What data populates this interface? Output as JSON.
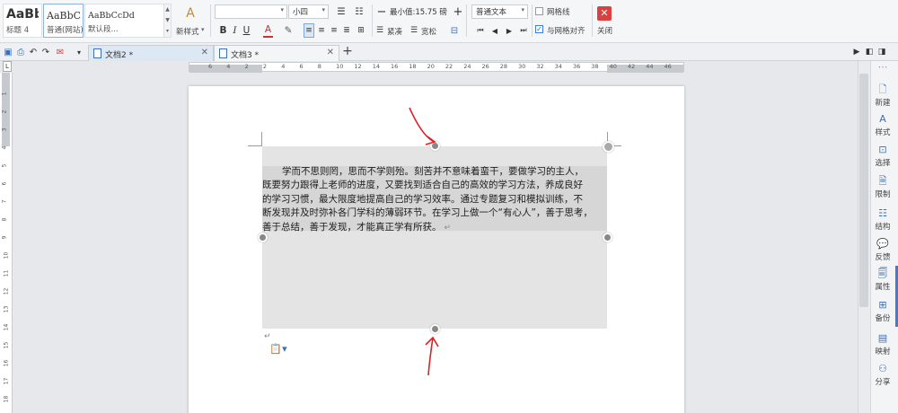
{
  "ribbon": {
    "styles": [
      {
        "preview": "AaBbC",
        "name": "标题 4"
      },
      {
        "preview": "AaBbCcl",
        "name": "普通(网站)"
      },
      {
        "preview": "AaBbCcDd",
        "name": "默认段..."
      }
    ],
    "new_style_label": "新样式",
    "font_name": "",
    "font_size": "小四",
    "line_spacing_label": "最小值:15.75 磅",
    "minus": "−",
    "plus": "+",
    "text_style": "普通文本",
    "gridlines_label": "网格线",
    "align_grid_label": "与网格对齐",
    "close_label": "关闭",
    "tight_label": "紧凑",
    "loose_label": "宽松",
    "bold": "B",
    "italic": "I",
    "underline": "U",
    "fontcolor": "A"
  },
  "tabs": [
    {
      "label": "文档2 *"
    },
    {
      "label": "文档3 *"
    }
  ],
  "new_tab": "+",
  "ruler": {
    "h_ticks": [
      "6",
      "4",
      "2",
      "2",
      "4",
      "6",
      "8",
      "10",
      "12",
      "14",
      "16",
      "18",
      "20",
      "22",
      "24",
      "26",
      "28",
      "30",
      "32",
      "34",
      "36",
      "38",
      "40",
      "42",
      "44",
      "46"
    ],
    "v_ticks": [
      "1",
      "2",
      "3",
      "4",
      "5",
      "6",
      "7",
      "8",
      "9",
      "10",
      "11",
      "12",
      "13",
      "14",
      "15",
      "16",
      "17",
      "18",
      "19"
    ]
  },
  "document": {
    "paragraph": "学而不思则罔，思而不学则殆。刻苦并不意味着蛮干，要做学习的主人，既要努力跟得上老师的进度，又要找到适合自己的高效的学习方法，养成良好的学习习惯，最大限度地提高自己的学习效率。通过专题复习和模拟训练，不断发现并及时弥补各门学科的薄弱环节。在学习上做一个“有心人”，善于思考，善于总结，善于发现，才能真正学有所获。",
    "para_mark": "↵",
    "lines": [
      "学而不思则罔，思而不学则殆。刻苦并不意味着蛮干，要做学习的主人，",
      "既要努力跟得上老师的进度，又要找到适合自己的高效的学习方法，养成良好",
      "的学习习惯，最大限度地提高自己的学习效率。通过专题复习和模拟训练，不",
      "断发现并及时弥补各门学科的薄弱环节。在学习上做一个“有心人”，善于思考，",
      "善于总结，善于发现，才能真正学有所获。"
    ],
    "after_mark": "↵"
  },
  "side_panel": [
    {
      "label": "新建",
      "icon": "new-doc-icon"
    },
    {
      "label": "样式",
      "icon": "style-icon"
    },
    {
      "label": "选择",
      "icon": "select-icon"
    },
    {
      "label": "限制",
      "icon": "restrict-icon"
    },
    {
      "label": "结构",
      "icon": "structure-icon"
    },
    {
      "label": "反馈",
      "icon": "feedback-icon"
    },
    {
      "label": "属性",
      "icon": "properties-icon"
    },
    {
      "label": "备份",
      "icon": "backup-icon"
    },
    {
      "label": "映射",
      "icon": "map-icon"
    },
    {
      "label": "分享",
      "icon": "share-icon"
    }
  ],
  "colors": {
    "accent": "#3d7bd9",
    "annotation": "#e02020",
    "close": "#d94040"
  }
}
